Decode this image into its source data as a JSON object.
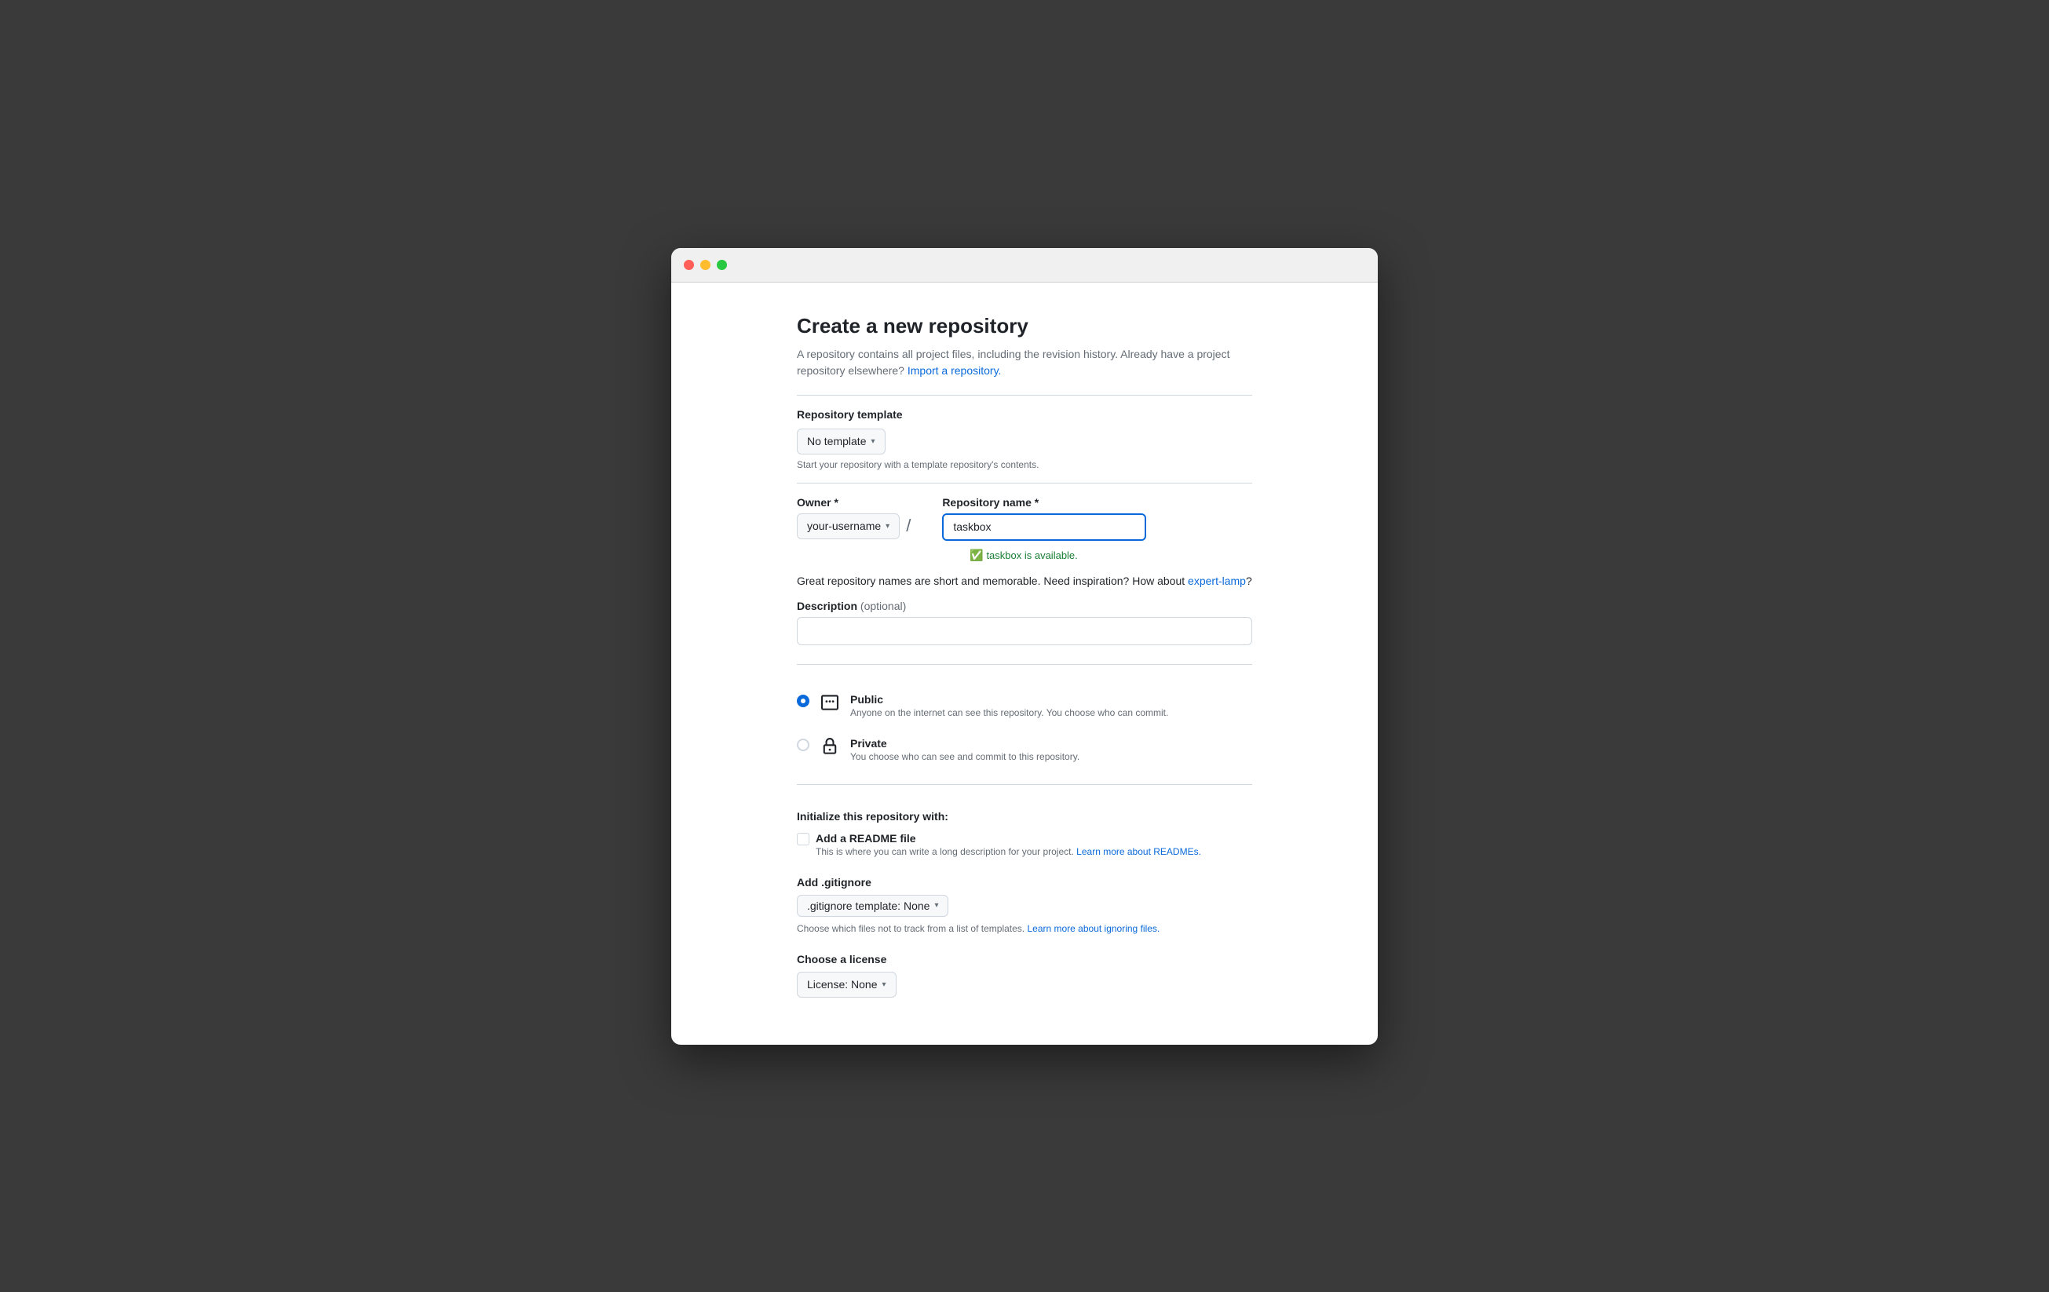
{
  "window": {
    "titlebar": {
      "traffic_lights": [
        "red",
        "yellow",
        "green"
      ]
    }
  },
  "page": {
    "title": "Create a new repository",
    "subtitle": "A repository contains all project files, including the revision history. Already have a project repository elsewhere?",
    "import_link": "Import a repository."
  },
  "repository_template": {
    "label": "Repository template",
    "dropdown_value": "No template",
    "helper": "Start your repository with a template repository's contents."
  },
  "owner": {
    "label": "Owner *",
    "value": "your-username"
  },
  "repo_name": {
    "label": "Repository name *",
    "value": "taskbox",
    "availability": "taskbox is available."
  },
  "inspiration": {
    "text": "Great repository names are short and memorable. Need inspiration? How about",
    "suggestion": "expert-lamp",
    "suffix": "?"
  },
  "description": {
    "label": "Description",
    "optional": "(optional)",
    "placeholder": ""
  },
  "visibility": {
    "options": [
      {
        "id": "public",
        "title": "Public",
        "description": "Anyone on the internet can see this repository. You choose who can commit.",
        "selected": true
      },
      {
        "id": "private",
        "title": "Private",
        "description": "You choose who can see and commit to this repository.",
        "selected": false
      }
    ]
  },
  "initialize": {
    "section_title": "Initialize this repository with:",
    "readme": {
      "title": "Add a README file",
      "description": "This is where you can write a long description for your project.",
      "link_text": "Learn more about READMEs.",
      "checked": false
    }
  },
  "gitignore": {
    "label": "Add .gitignore",
    "dropdown_value": ".gitignore template: None",
    "helper_text": "Choose which files not to track from a list of templates.",
    "helper_link": "Learn more about ignoring files."
  },
  "license": {
    "label": "Choose a license",
    "dropdown_value": "License: None"
  }
}
